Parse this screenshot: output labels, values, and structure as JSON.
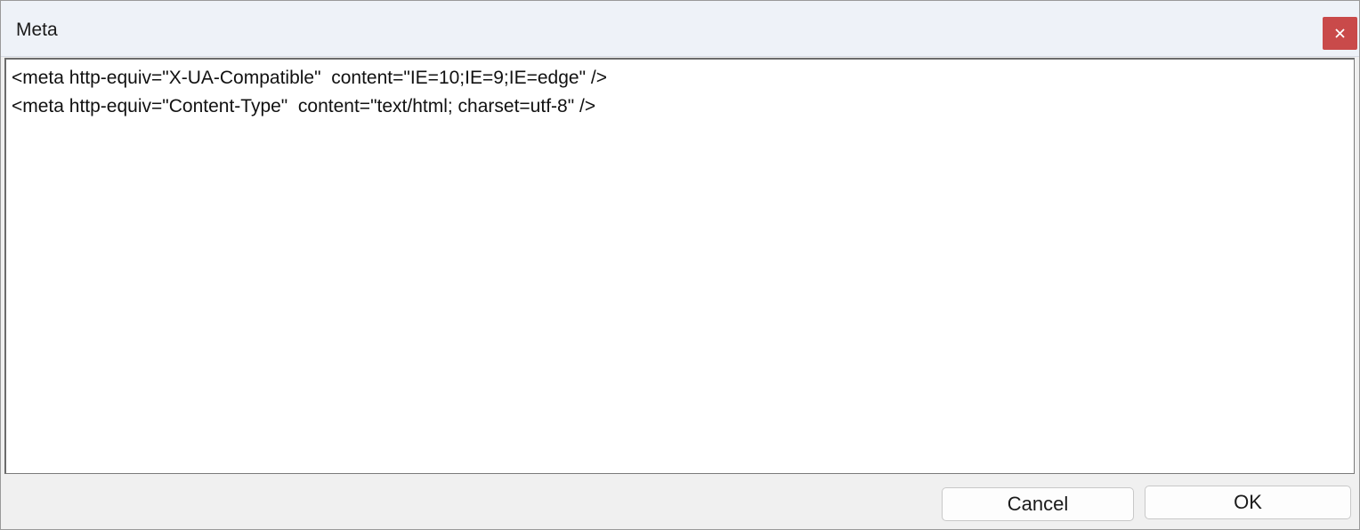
{
  "window": {
    "title": "Meta",
    "close_icon": "close-icon",
    "accent_close_color": "#c94a4a"
  },
  "editor": {
    "lines": [
      "<meta http-equiv=\"X-UA-Compatible\"  content=\"IE=10;IE=9;IE=edge\" />",
      "<meta http-equiv=\"Content-Type\"  content=\"text/html; charset=utf-8\" />"
    ]
  },
  "buttons": {
    "cancel_label": "Cancel",
    "ok_label": "OK"
  }
}
